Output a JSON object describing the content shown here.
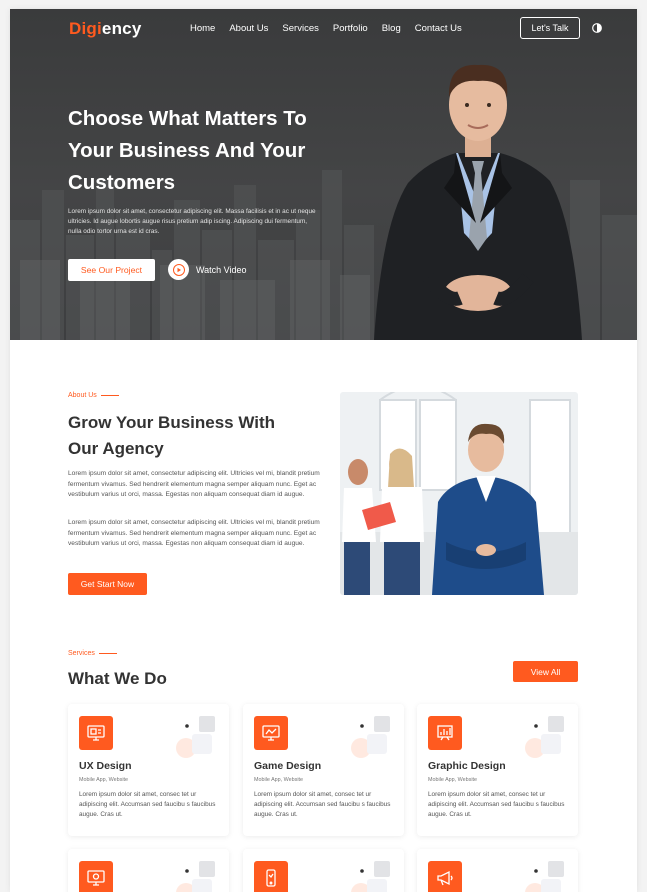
{
  "header": {
    "logo_part1": "Digi",
    "logo_part2": "ency",
    "nav": [
      "Home",
      "About Us",
      "Services",
      "Portfolio",
      "Blog",
      "Contact Us"
    ],
    "cta": "Let's Talk",
    "theme_icon": "half-moon-icon"
  },
  "hero": {
    "title": "Choose What Matters To Your Business And Your Customers",
    "text": "Lorem ipsum dolor sit amet, consectetur adipiscing elit. Massa facilisis et in ac ut neque ultricies. Id augue lobortis augue risus pretium adip iscing. Adipiscing dui fermentum, nulla odio tortor urna est id cras.",
    "primary_button": "See Our Project",
    "video_button": "Watch Video"
  },
  "about": {
    "eyebrow": "About Us",
    "title": "Grow Your Business With Our Agency",
    "para1": "Lorem ipsum dolor sit amet, consectetur adipiscing elit. Ultricies vel mi, blandit pretium fermentum vivamus. Sed hendrerit elementum magna semper aliquam nunc. Eget ac vestibulum varius ut orci, massa. Egestas non aliquam consequat diam id augue.",
    "para2": "Lorem ipsum dolor sit amet, consectetur adipiscing elit. Ultricies vel mi, blandit pretium fermentum vivamus. Sed hendrerit elementum magna semper aliquam nunc. Eget ac vestibulum varius ut orci, massa. Egestas non aliquam consequat diam id augue.",
    "button": "Get Start Now"
  },
  "services": {
    "eyebrow": "Services",
    "title": "What We Do",
    "view_all": "View All",
    "cards": [
      {
        "title": "UX Design",
        "sub": "Mobile App, Website",
        "text": "Lorem ipsum dolor sit amet, consec tet ur adipiscing elit. Accumsan sed faucibu s faucibus augue. Cras ut.",
        "icon": "ux-screen-icon"
      },
      {
        "title": "Game Design",
        "sub": "Mobile App, Website",
        "text": "Lorem ipsum dolor sit amet, consec tet ur adipiscing elit. Accumsan sed faucibu s faucibus augue. Cras ut.",
        "icon": "monitor-icon"
      },
      {
        "title": "Graphic Design",
        "sub": "Mobile App, Website",
        "text": "Lorem ipsum dolor sit amet, consec tet ur adipiscing elit. Accumsan sed faucibu s faucibus augue. Cras ut.",
        "icon": "chart-board-icon"
      }
    ],
    "row2_icons": [
      "computer-icon",
      "mobile-icon",
      "megaphone-icon"
    ]
  },
  "colors": {
    "accent": "#ff5a1f",
    "hero_bg": "#3f4041",
    "text": "#333333"
  }
}
